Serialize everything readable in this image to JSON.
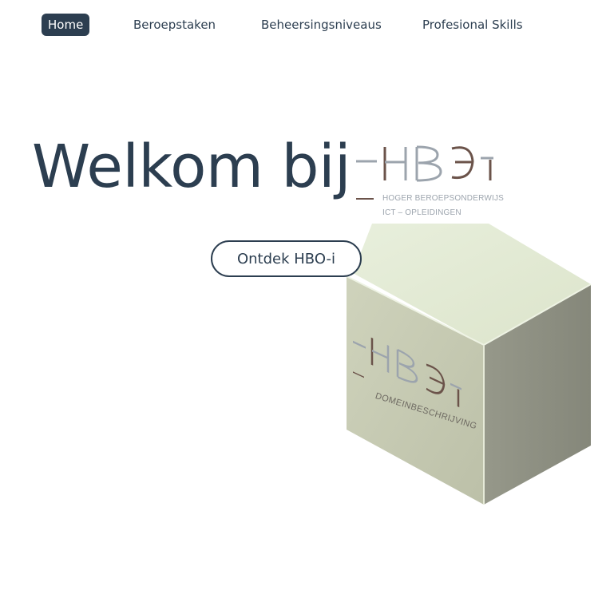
{
  "nav": {
    "items": [
      {
        "label": "Home",
        "active": true
      },
      {
        "label": "Beroepstaken",
        "active": false
      },
      {
        "label": "Beheersingsniveaus",
        "active": false
      },
      {
        "label": "Profesional Skills",
        "active": false
      }
    ]
  },
  "hero": {
    "title": "Welkom bij",
    "cta_label": "Ontdek HBO-i"
  },
  "logo": {
    "wordmark": "HBO-i",
    "line1": "HOGER BEROEPSONDERWIJS",
    "line2": "ICT – OPLEIDINGEN"
  },
  "cube": {
    "label": "DOMEINBESCHRIJVING"
  },
  "colors": {
    "primary": "#2c3e50",
    "logo_gray": "#9ca4ad",
    "logo_brown": "#6b534a",
    "cube_top": "#e4ecd6",
    "cube_left": "#c7cbb3",
    "cube_right": "#8d8f80"
  }
}
